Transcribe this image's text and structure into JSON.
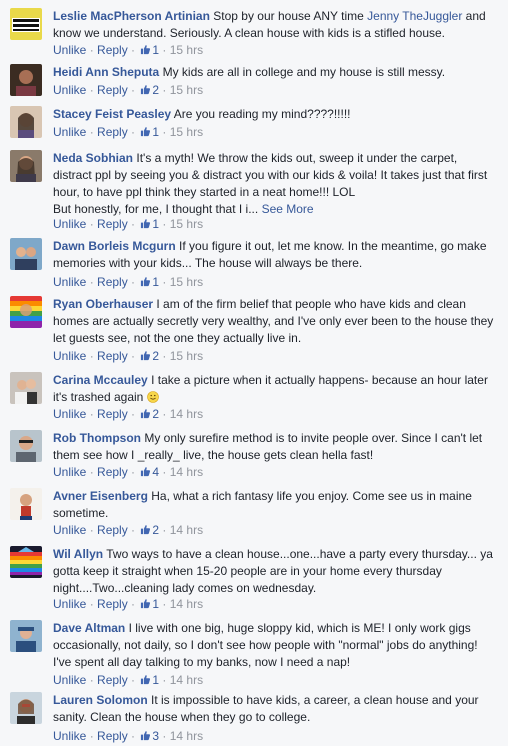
{
  "comments": [
    {
      "author": "Leslie MacPherson Artinian",
      "text": "Stop by our house ANY time ",
      "mention": "Jenny TheJuggler",
      "text2": " and know we understand. Seriously. A clean house with kids is a stifled house.",
      "actions": {
        "unlike": "Unlike",
        "reply": "Reply",
        "likes": "1",
        "time": "15 hrs"
      },
      "avatar_badge": "BLACK LIVES MATTER"
    },
    {
      "author": "Heidi Ann Sheputa",
      "text": "My kids are all in college and my house is still messy.",
      "actions": {
        "unlike": "Unlike",
        "reply": "Reply",
        "likes": "2",
        "time": "15 hrs"
      }
    },
    {
      "author": "Stacey Feist Peasley",
      "text": "Are you reading my mind????!!!!!",
      "actions": {
        "unlike": "Unlike",
        "reply": "Reply",
        "likes": "1",
        "time": "15 hrs"
      }
    },
    {
      "author": "Neda Sobhian",
      "text": "It's a myth! We throw the kids out, sweep it under the carpet, distract ppl by seeing you & distract you with our kids & voila! It takes just that first hour, to have ppl think they started in a neat home!!! LOL",
      "text2": "But honestly, for me, I thought that I i...",
      "more": "See More",
      "actions": {
        "unlike": "Unlike",
        "reply": "Reply",
        "likes": "1",
        "time": "15 hrs"
      }
    },
    {
      "author": "Dawn Borleis Mcgurn",
      "text": "If you figure it out, let me know. In the meantime, go make memories with your kids... The house will always be there.",
      "actions": {
        "unlike": "Unlike",
        "reply": "Reply",
        "likes": "1",
        "time": "15 hrs"
      }
    },
    {
      "author": "Ryan Oberhauser",
      "text": "I am of the firm belief that people who have kids and clean homes are actually secretly very wealthy, and I've only ever been to the house they let guests see, not the one they actually live in.",
      "actions": {
        "unlike": "Unlike",
        "reply": "Reply",
        "likes": "2",
        "time": "15 hrs"
      }
    },
    {
      "author": "Carina Mccauley",
      "text": "I take a picture when it actually happens- because an hour later it's trashed again ",
      "actions": {
        "unlike": "Unlike",
        "reply": "Reply",
        "likes": "2",
        "time": "14 hrs"
      }
    },
    {
      "author": "Rob Thompson",
      "text": "My only surefire method is to invite people over. Since I can't let them see how I _really_ live, the house gets clean hella fast!",
      "actions": {
        "unlike": "Unlike",
        "reply": "Reply",
        "likes": "4",
        "time": "14 hrs"
      }
    },
    {
      "author": "Avner Eisenberg",
      "text": "Ha, what a rich fantasy life you enjoy. Come see us in maine sometime.",
      "actions": {
        "unlike": "Unlike",
        "reply": "Reply",
        "likes": "2",
        "time": "14 hrs"
      }
    },
    {
      "author": "Wil Allyn",
      "text": "Two ways to have a clean house...one...have a party every thursday... ya gotta keep it straight when 15-20 people are in your home every thursday night....Two...cleaning lady comes on wednesday.",
      "actions": {
        "unlike": "Unlike",
        "reply": "Reply",
        "likes": "1",
        "time": "14 hrs"
      }
    },
    {
      "author": "Dave Altman",
      "text": "I live with one big, huge sloppy kid, which is ME! I only work gigs occasionally, not daily, so I don't see how people with \"normal\" jobs do anything! I've spent all day talking to my banks, now I need a nap!",
      "actions": {
        "unlike": "Unlike",
        "reply": "Reply",
        "likes": "1",
        "time": "14 hrs"
      }
    },
    {
      "author": "Lauren Solomon",
      "text": "It is impossible to have kids, a career, a clean house and your sanity. Clean the house when they go to college.",
      "actions": {
        "unlike": "Unlike",
        "reply": "Reply",
        "likes": "3",
        "time": "14 hrs"
      }
    }
  ],
  "colors": {
    "link": "#365899",
    "meta": "#90949c",
    "text": "#1d2129",
    "background": "#f6f7f9"
  }
}
